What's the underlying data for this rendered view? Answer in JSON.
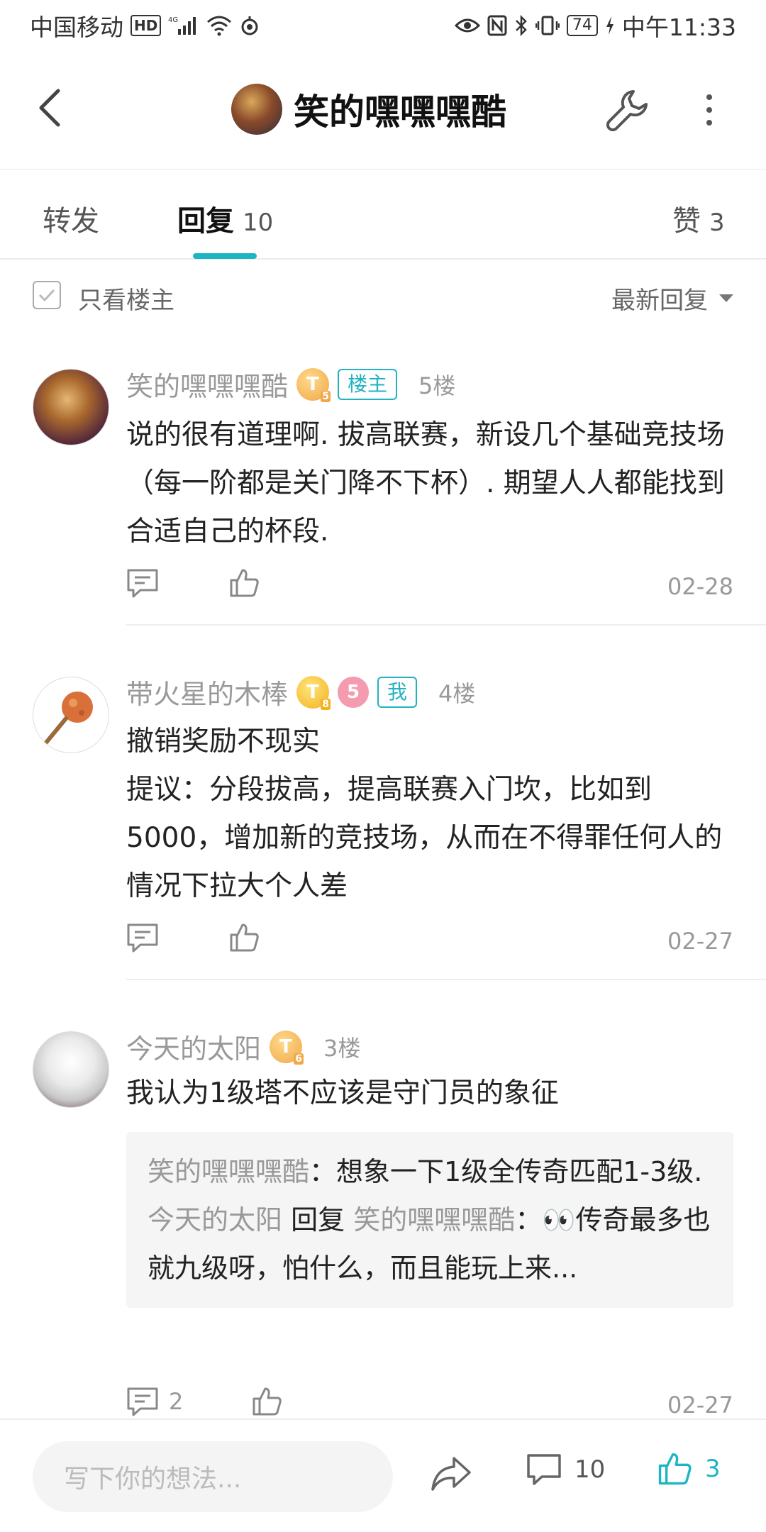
{
  "status_bar": {
    "carrier": "中国移动",
    "hd": "HD",
    "network": "4G",
    "battery": "74",
    "time": "中午11:33"
  },
  "nav": {
    "title": "笑的嘿嘿嘿酷"
  },
  "tabs": [
    {
      "label": "转发",
      "count": ""
    },
    {
      "label": "回复",
      "count": "10"
    },
    {
      "label": "赞",
      "count": "3"
    }
  ],
  "filter": {
    "only_op_label": "只看楼主",
    "sort_label": "最新回复"
  },
  "posts": [
    {
      "username": "笑的嘿嘿嘿酷",
      "level": "T",
      "level_sub": "5",
      "tag": "楼主",
      "floor": "5楼",
      "content": "说的很有道理啊. 拔高联赛，新设几个基础竞技场（每一阶都是关门降不下杯）. 期望人人都能找到合适自己的杯段.",
      "comment_count": "",
      "date": "02-28"
    },
    {
      "username": "带火星的木棒",
      "level": "T",
      "level_sub": "8",
      "pink_badge": "5",
      "tag": "我",
      "floor": "4楼",
      "content_lines": [
        "撤销奖励不现实",
        "提议：分段拔高，提高联赛入门坎，比如到5000，增加新的竞技场，从而在不得罪任何人的情况下拉大个人差"
      ],
      "comment_count": "",
      "date": "02-27"
    },
    {
      "username": "今天的太阳",
      "level": "T",
      "level_sub": "6",
      "floor": "3楼",
      "content": "我认为1级塔不应该是守门员的象征",
      "quotes": [
        {
          "name": "笑的嘿嘿嘿酷",
          "sep": "：",
          "text": "想象一下1级全传奇匹配1-3级."
        },
        {
          "name": "今天的太阳",
          "reply": " 回复 ",
          "to": "笑的嘿嘿嘿酷",
          "sep": "：",
          "text": "👀传奇最多也就九级呀，怕什么，而且能玩上来..."
        }
      ],
      "comment_count": "2",
      "date": "02-27"
    }
  ],
  "bottom_bar": {
    "input_placeholder": "写下你的想法...",
    "comment_count": "10",
    "like_count": "3"
  },
  "colors": {
    "accent": "#1db5c4",
    "muted_text": "#999999",
    "badge_gold": "#f2b21f"
  }
}
